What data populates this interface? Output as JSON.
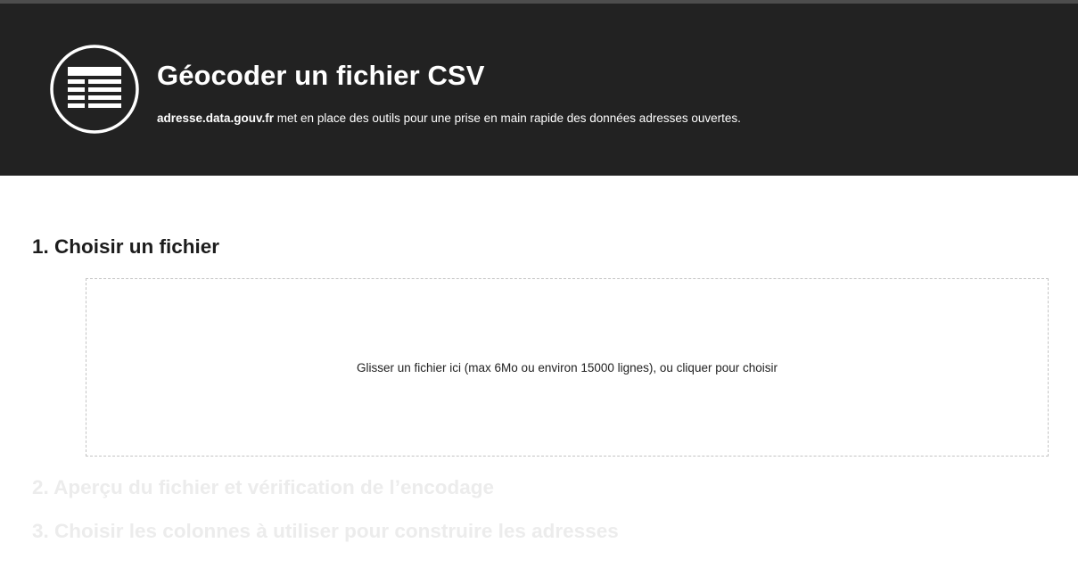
{
  "header": {
    "title": "Géocoder un fichier CSV",
    "subtitle_site": "adresse.data.gouv.fr",
    "subtitle_text": " met en place des outils pour une prise en main rapide des données adresses ouvertes.",
    "logo_icon": "table-list-icon"
  },
  "steps": [
    {
      "label": "1. Choisir un fichier",
      "state": "active"
    },
    {
      "label": "2. Aperçu du fichier et vérification de l’encodage",
      "state": "disabled"
    },
    {
      "label": "3. Choisir les colonnes à utiliser pour construire les adresses",
      "state": "disabled"
    }
  ],
  "dropzone": {
    "text": "Glisser un fichier ici (max 6Mo ou environ 15000 lignes), ou cliquer pour choisir"
  },
  "colors": {
    "header_bg": "#222222",
    "active_step": "#1c1c1c",
    "disabled_step": "#ececec",
    "dropzone_border": "#c4c4c4"
  }
}
